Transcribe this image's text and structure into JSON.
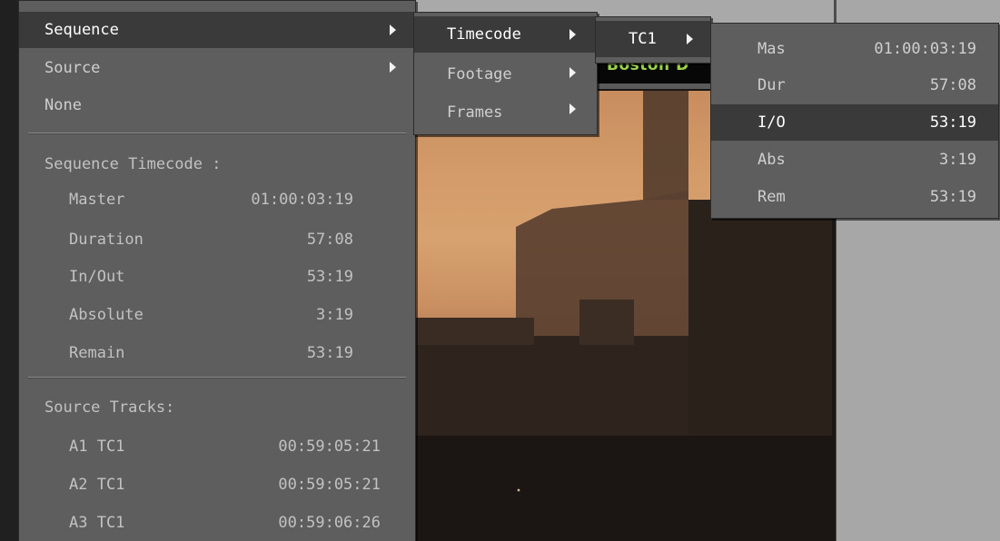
{
  "menu_main": {
    "items": [
      {
        "label": "Sequence"
      },
      {
        "label": "Source"
      },
      {
        "label": "None"
      }
    ],
    "sequence_timecode": {
      "header": "Sequence Timecode :",
      "rows": [
        {
          "label": "Master",
          "value": "01:00:03:19"
        },
        {
          "label": "Duration",
          "value": "57:08"
        },
        {
          "label": "In/Out",
          "value": "53:19"
        },
        {
          "label": "Absolute",
          "value": "3:19"
        },
        {
          "label": "Remain",
          "value": "53:19"
        }
      ]
    },
    "source_tracks": {
      "header": "Source Tracks:",
      "rows": [
        {
          "label": "A1 TC1",
          "value": "00:59:05:21"
        },
        {
          "label": "A2 TC1",
          "value": "00:59:05:21"
        },
        {
          "label": "A3 TC1",
          "value": "00:59:06:26"
        }
      ]
    }
  },
  "menu_sequence": {
    "items": [
      {
        "label": "Timecode"
      },
      {
        "label": "Footage"
      },
      {
        "label": "Frames"
      }
    ]
  },
  "menu_timecode": {
    "items": [
      {
        "label": "TC1"
      }
    ]
  },
  "menu_tc1": {
    "rows": [
      {
        "label": "Mas",
        "value": "01:00:03:19"
      },
      {
        "label": "Dur",
        "value": "57:08"
      },
      {
        "label": "I/O",
        "value": "53:19"
      },
      {
        "label": "Abs",
        "value": "3:19"
      },
      {
        "label": "Rem",
        "value": "53:19"
      }
    ],
    "selected": "I/O"
  },
  "background": {
    "timecode_display_text": "Boston D"
  },
  "colors": {
    "menu_bg": "#5e5e5e",
    "highlight_bg": "#3a3a3a",
    "timecode_green": "#9ad34a"
  }
}
